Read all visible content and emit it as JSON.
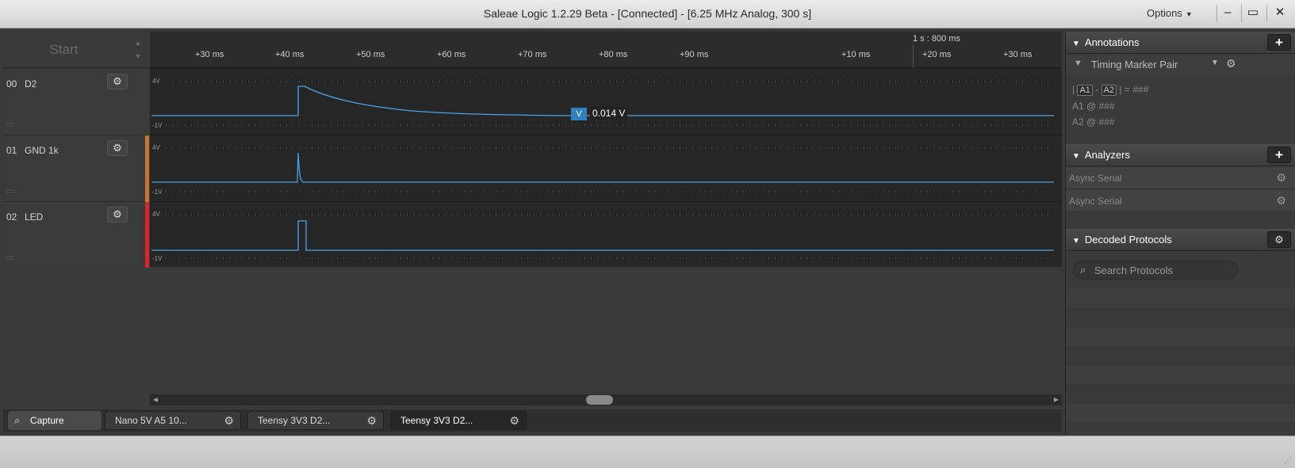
{
  "window": {
    "title": "Saleae Logic 1.2.29 Beta - [Connected] - [6.25 MHz Analog, 300 s]",
    "options_label": "Options",
    "minimize_icon": "minimize-icon",
    "maximize_icon": "maximize-icon",
    "close_icon": "close-icon"
  },
  "start_label": "Start",
  "channels": [
    {
      "num": "00",
      "name": "D2",
      "color": "#3a3a3a",
      "v_hi": "4V",
      "v_lo": "-1V"
    },
    {
      "num": "01",
      "name": "GND 1k",
      "color": "#c8742c",
      "v_hi": "4V",
      "v_lo": "-1V"
    },
    {
      "num": "02",
      "name": "LED",
      "color": "#d8262a",
      "v_hi": "4V",
      "v_lo": "-1V"
    }
  ],
  "ruler": {
    "scale": "1 s : 800 ms",
    "ticks": [
      "+30 ms",
      "+40 ms",
      "+50 ms",
      "+60 ms",
      "+70 ms",
      "+80 ms",
      "+90 ms",
      "+10 ms",
      "+20 ms",
      "+30 ms"
    ]
  },
  "measurement": {
    "badge": "V",
    "value": "0.014 V"
  },
  "tabs": {
    "capture": "Capture",
    "items": [
      "Nano 5V A5 10...",
      "Teensy 3V3 D2...",
      "Teensy 3V3 D2..."
    ]
  },
  "annotations": {
    "title": "Annotations",
    "marker": "Timing Marker Pair",
    "expr_a1": "A1",
    "expr_dash": "-",
    "expr_a2": "A2",
    "expr_eq": "| = ###",
    "a1_line": "A1  @  ###",
    "a2_line": "A2  @  ###"
  },
  "analyzers": {
    "title": "Analyzers",
    "items": [
      "Async Serial",
      "Async Serial"
    ]
  },
  "decoded": {
    "title": "Decoded Protocols",
    "search_placeholder": "Search Protocols"
  },
  "colors": {
    "trace": "#4aa3e8",
    "accent_blue": "#2f7fc1"
  }
}
